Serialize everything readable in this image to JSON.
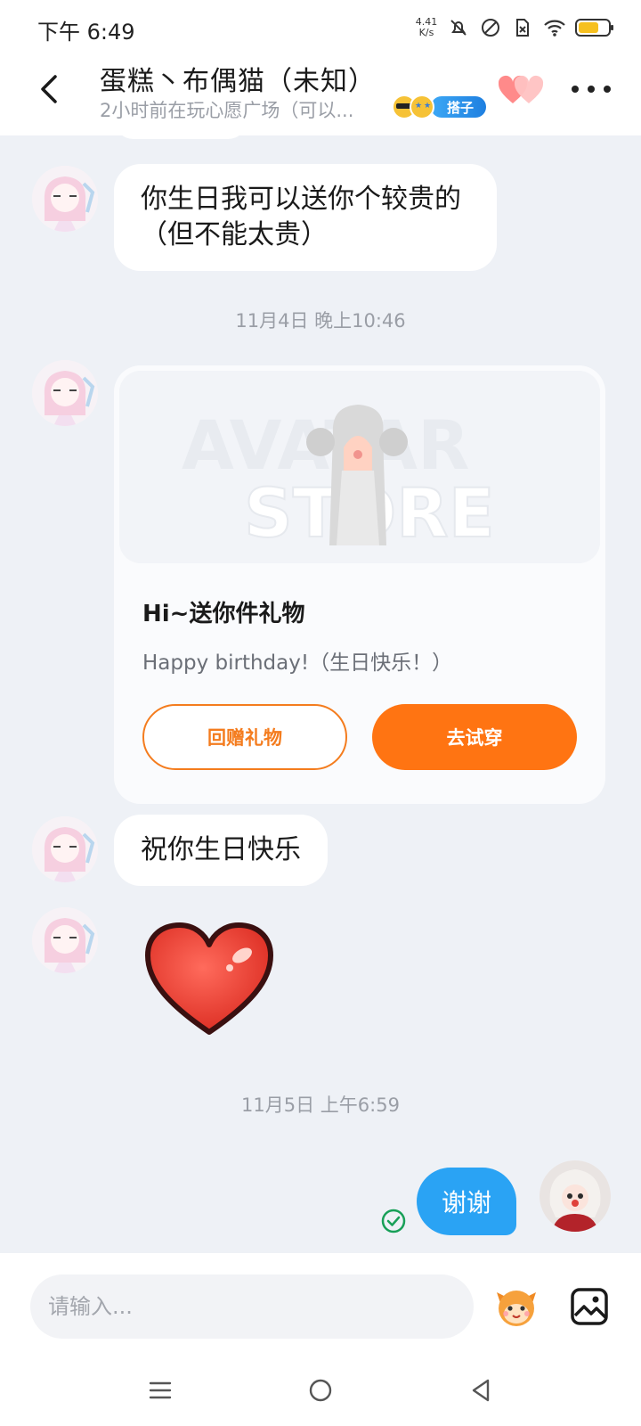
{
  "status_bar": {
    "time": "下午 6:49",
    "net_speed_value": "4.41",
    "net_speed_unit": "K/s",
    "icons": [
      "bell-off-icon",
      "dnd-icon",
      "sim-off-icon",
      "wifi-icon",
      "battery-icon"
    ]
  },
  "header": {
    "title": "蛋糕丶布偶猫（未知）",
    "subtitle": "2小时前在玩心愿广场（可以...",
    "partner_badge": "搭子"
  },
  "messages": [
    {
      "from": "other",
      "type": "text",
      "text": "你生日我可以送你个较贵的（但不能太贵）"
    },
    {
      "type": "timestamp",
      "text": "11月4日 晚上10:46"
    },
    {
      "from": "other",
      "type": "gift",
      "image_watermark_top": "AVATAR",
      "image_watermark_bottom": "STORE",
      "title": "Hi~送你件礼物",
      "message": "Happy birthday!（生日快乐！）",
      "button_return": "回赠礼物",
      "button_try": "去试穿"
    },
    {
      "from": "other",
      "type": "text",
      "text": "祝你生日快乐"
    },
    {
      "from": "other",
      "type": "sticker",
      "sticker": "red-heart"
    },
    {
      "type": "timestamp",
      "text": "11月5日 上午6:59"
    },
    {
      "from": "me",
      "type": "text",
      "text": "谢谢",
      "status": "read"
    }
  ],
  "input": {
    "placeholder": "请输入..."
  },
  "colors": {
    "accent_orange": "#ff7412",
    "my_bubble": "#2aa3f4",
    "chat_background": "#eef1f6",
    "read_check": "#18a058"
  }
}
